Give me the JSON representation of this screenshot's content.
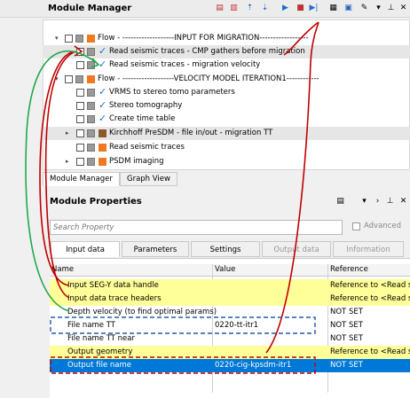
{
  "module_manager": {
    "title": "Module Manager",
    "tree": [
      {
        "label": "Flow - -------------------INPUT FOR MIGRATION------------------",
        "kind": "flow",
        "checked": false
      },
      {
        "label": "Read seismic traces - CMP gathers before migration",
        "kind": "module",
        "checked": true
      },
      {
        "label": "Read seismic traces - migration velocity",
        "kind": "module",
        "checked": true
      },
      {
        "label": "Flow - -------------------VELOCITY MODEL ITERATION1------------",
        "kind": "flow",
        "checked": false
      },
      {
        "label": "VRMS to stereo tomo parameters",
        "kind": "module",
        "checked": true
      },
      {
        "label": "Stereo tomography",
        "kind": "module",
        "checked": true
      },
      {
        "label": "Create time table",
        "kind": "module",
        "checked": true
      },
      {
        "label": "Kirchhoff PreSDM - file in/out - migration TT",
        "kind": "module",
        "checked": false
      },
      {
        "label": "Read seismic traces",
        "kind": "module",
        "checked": false
      },
      {
        "label": "PSDM imaging",
        "kind": "module",
        "checked": false
      }
    ],
    "tabs": [
      "Module Manager",
      "Graph View"
    ]
  },
  "module_properties": {
    "title": "Module Properties",
    "search_placeholder": "Search Property",
    "advanced_label": "Advanced",
    "tabs": [
      "Input data",
      "Parameters",
      "Settings",
      "Output data",
      "Information"
    ],
    "columns": [
      "Name",
      "Value",
      "Reference"
    ],
    "rows": [
      {
        "name": "Input SEG-Y data handle",
        "value": "",
        "reference": "Reference to <Read s",
        "style": "yellow"
      },
      {
        "name": "Input data trace headers",
        "value": "",
        "reference": "Reference to <Read s",
        "style": "yellow"
      },
      {
        "name": "Depth velocity (to find optimal params)",
        "value": "",
        "reference": "NOT SET",
        "style": "plain"
      },
      {
        "name": "File name TT",
        "value": "0220-tt-itr1",
        "reference": "NOT SET",
        "style": "plain"
      },
      {
        "name": "File name TT near",
        "value": "",
        "reference": "NOT SET",
        "style": "plain"
      },
      {
        "name": "Output geometry",
        "value": "",
        "reference": "Reference to <Read s",
        "style": "yellow"
      },
      {
        "name": "Output file name",
        "value": "0220-cig-kpsdm-itr1",
        "reference": "NOT SET",
        "style": "selected"
      }
    ]
  },
  "colors": {
    "accent_blue": "#0078d7",
    "highlight_yellow": "#ffff99",
    "annotation_red": "#c00000",
    "annotation_green": "#22a84a",
    "flow_orange": "#f07820"
  }
}
